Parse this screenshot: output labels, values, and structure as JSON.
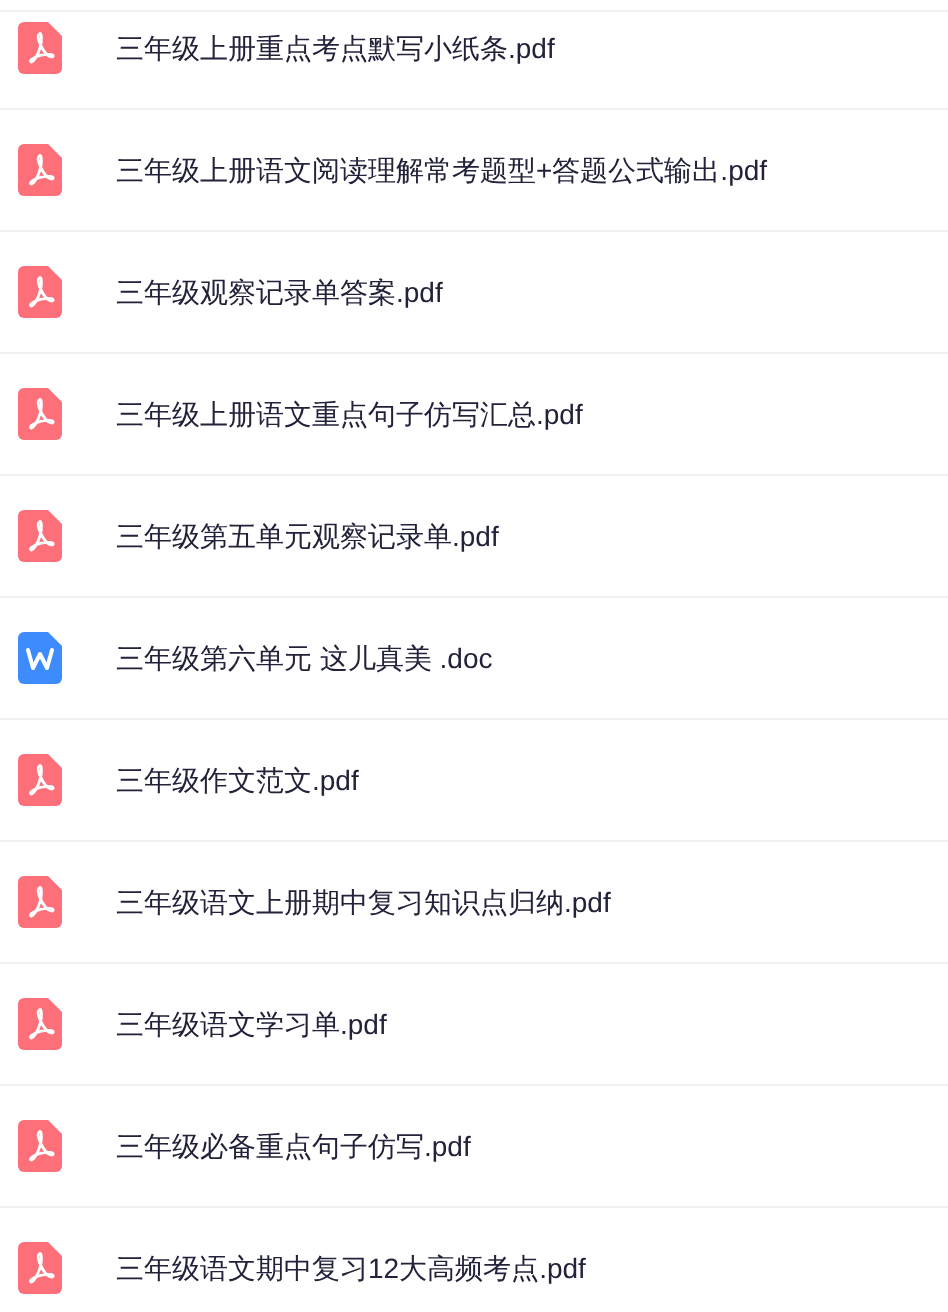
{
  "files": [
    {
      "kind": "pdf",
      "name": "三年级上册重点考点默写小纸条.pdf"
    },
    {
      "kind": "pdf",
      "name": "三年级上册语文阅读理解常考题型+答题公式输出.pdf"
    },
    {
      "kind": "pdf",
      "name": "三年级观察记录单答案.pdf"
    },
    {
      "kind": "pdf",
      "name": "三年级上册语文重点句子仿写汇总.pdf"
    },
    {
      "kind": "pdf",
      "name": "三年级第五单元观察记录单.pdf"
    },
    {
      "kind": "doc",
      "name": "三年级第六单元 这儿真美 .doc"
    },
    {
      "kind": "pdf",
      "name": "三年级作文范文.pdf"
    },
    {
      "kind": "pdf",
      "name": "三年级语文上册期中复习知识点归纳.pdf"
    },
    {
      "kind": "pdf",
      "name": "三年级语文学习单.pdf"
    },
    {
      "kind": "pdf",
      "name": "三年级必备重点句子仿写.pdf"
    },
    {
      "kind": "pdf",
      "name": "三年级语文期中复习12大高频考点.pdf"
    }
  ]
}
